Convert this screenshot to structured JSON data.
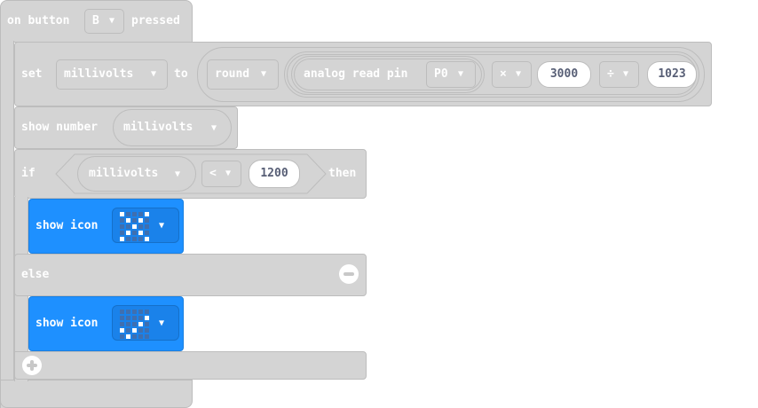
{
  "event": {
    "prefix": "on button",
    "button": "B",
    "suffix": "pressed"
  },
  "set": {
    "label": "set",
    "variable": "millivolts",
    "to": "to",
    "func": "round",
    "read_label": "analog read pin",
    "pin": "P0",
    "op1": "×",
    "val1": "3000",
    "op2": "÷",
    "val2": "1023"
  },
  "show_number": {
    "label": "show number",
    "variable": "millivolts"
  },
  "if_block": {
    "if_label": "if",
    "variable": "millivolts",
    "op": "<",
    "value": "1200",
    "then_label": "then",
    "else_label": "else"
  },
  "show_icon_1": {
    "label": "show icon",
    "pixels": [
      1,
      0,
      0,
      0,
      1,
      0,
      1,
      0,
      1,
      0,
      0,
      0,
      1,
      0,
      0,
      0,
      1,
      0,
      1,
      0,
      1,
      0,
      0,
      0,
      1
    ]
  },
  "show_icon_2": {
    "label": "show icon",
    "pixels": [
      0,
      0,
      0,
      0,
      0,
      0,
      0,
      0,
      0,
      1,
      0,
      0,
      0,
      1,
      0,
      1,
      0,
      1,
      0,
      0,
      0,
      1,
      0,
      0,
      0
    ]
  },
  "colors": {
    "block_gray": "#d4d4d4",
    "block_blue": "#1e90ff",
    "text": "#ffffff"
  }
}
